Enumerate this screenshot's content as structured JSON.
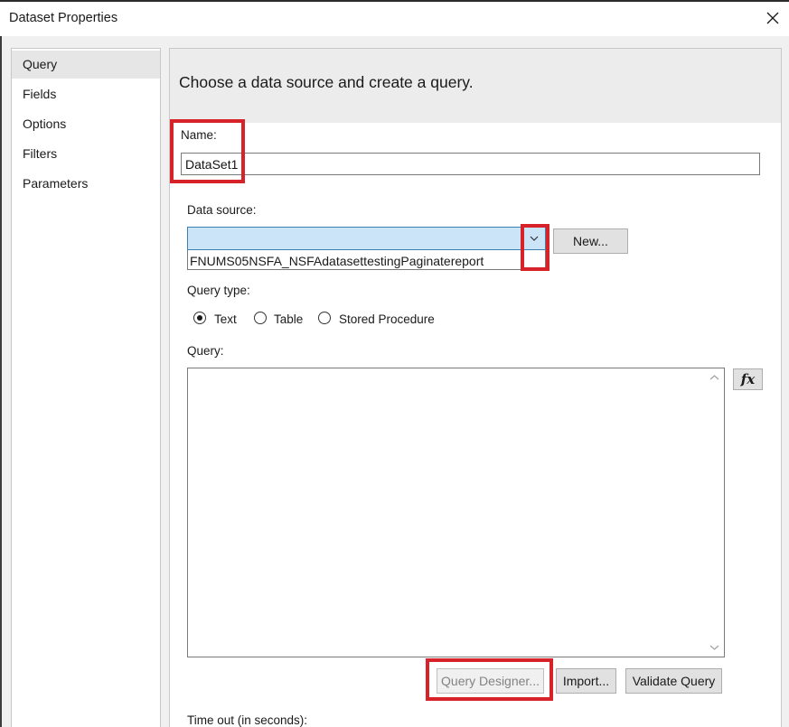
{
  "window": {
    "title": "Dataset Properties"
  },
  "nav": {
    "items": [
      {
        "label": "Query",
        "selected": true
      },
      {
        "label": "Fields"
      },
      {
        "label": "Options"
      },
      {
        "label": "Filters"
      },
      {
        "label": "Parameters"
      }
    ]
  },
  "main": {
    "heading": "Choose a data source and create a query.",
    "name_label": "Name:",
    "name_value": "DataSet1",
    "datasource_label": "Data source:",
    "datasource_value": "",
    "datasource_option": "FNUMS05NSFA_NSFAdatasettestingPaginatereport",
    "new_button": "New...",
    "query_type_label": "Query type:",
    "query_types": [
      {
        "label": "Text",
        "checked": true
      },
      {
        "label": "Table",
        "checked": false
      },
      {
        "label": "Stored Procedure",
        "checked": false
      }
    ],
    "query_label": "Query:",
    "query_value": "",
    "fx_label": "fx",
    "query_designer_button": "Query Designer...",
    "import_button": "Import...",
    "validate_button": "Validate Query",
    "timeout_label": "Time out (in seconds):"
  },
  "colors": {
    "highlight": "#d8222a",
    "combo_selected": "#cce4f7"
  }
}
